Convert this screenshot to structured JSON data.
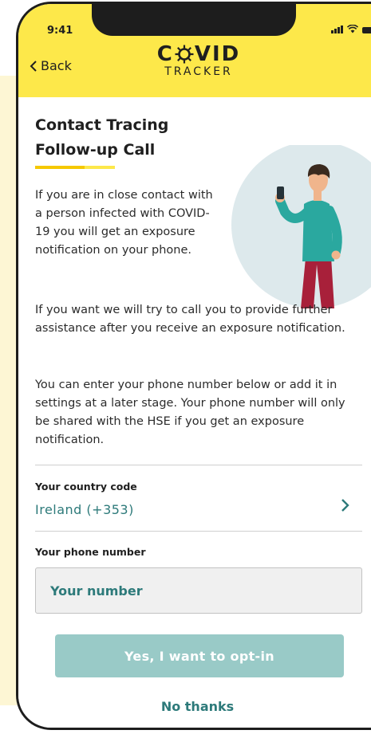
{
  "status_bar": {
    "time": "9:41",
    "icons": [
      "signal-icon",
      "wifi-icon",
      "battery-icon"
    ]
  },
  "header": {
    "back_label": "Back",
    "brand_word_left": "C",
    "brand_word_right": "VID",
    "brand_sub": "TRACKER",
    "background_color": "#fde84a"
  },
  "page": {
    "title_line1": "Contact Tracing",
    "title_line2": "Follow-up Call",
    "paragraph_1": "If you are in close contact with a person infected with COVID-19 you will get an exposure notification on your phone.",
    "paragraph_2": "If you want we will try to call you to provide further assistance after you receive an exposure notification.",
    "paragraph_3": "You can enter your phone number below or add it in settings at a later stage. Your phone number will only be shared with the HSE if you get an exposure notification."
  },
  "form": {
    "country_label": "Your country code",
    "country_value": "Ireland (+353)",
    "phone_label": "Your phone number",
    "phone_placeholder": "Your number",
    "phone_value": ""
  },
  "actions": {
    "optin_label": "Yes, I want to opt-in",
    "no_thanks_label": "No thanks"
  },
  "colors": {
    "accent": "#2d7a7a",
    "button_disabled": "#99cac7",
    "brand_yellow": "#fde84a"
  }
}
